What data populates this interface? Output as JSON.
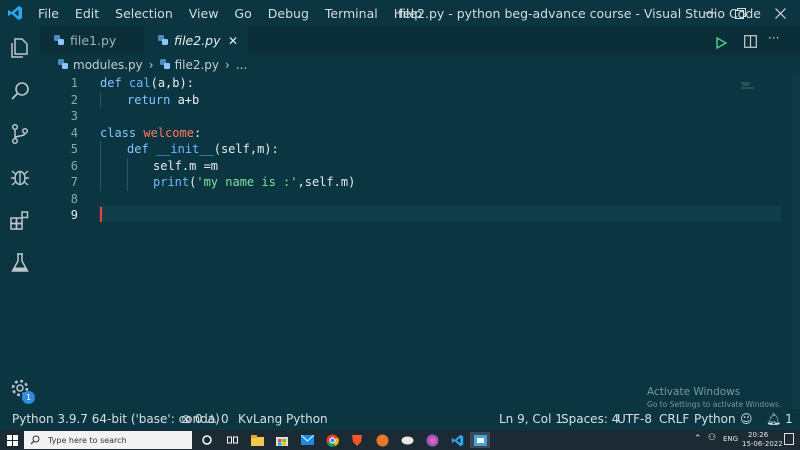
{
  "titlebar": {
    "menu": [
      "File",
      "Edit",
      "Selection",
      "View",
      "Go",
      "Debug",
      "Terminal",
      "Help"
    ],
    "title": "file2.py - python beg-advance course - Visual Studio Code"
  },
  "activitybar": {
    "icons": [
      "files-icon",
      "search-icon",
      "source-control-icon",
      "debug-icon",
      "extensions-icon",
      "flask-icon"
    ],
    "settings_badge": "1"
  },
  "tabs": [
    {
      "label": "file1.py",
      "active": false
    },
    {
      "label": "file2.py",
      "active": true,
      "close": "✕"
    }
  ],
  "breadcrumb": {
    "items": [
      "modules.py",
      "file2.py",
      "..."
    ]
  },
  "editor": {
    "lines": [
      {
        "num": "1"
      },
      {
        "num": "2"
      },
      {
        "num": "3"
      },
      {
        "num": "4"
      },
      {
        "num": "5"
      },
      {
        "num": "6"
      },
      {
        "num": "7"
      },
      {
        "num": "8"
      },
      {
        "num": "9"
      }
    ],
    "tokens": {
      "l1_kw": "def",
      "l1_fn": "cal",
      "l1_rest": "(a,b):",
      "l2_kw": "return",
      "l2_rest": " a+b",
      "l4_kw": "class",
      "l4_cls": "welcome",
      "l4_rest": ":",
      "l5_kw": "def",
      "l5_fn": "__init__",
      "l5_rest": "(self,m):",
      "l6_rest": "self.m =m",
      "l7_fn": "print",
      "l7_p1": "(",
      "l7_str": "'my name is :'",
      "l7_p2": ",self.m)"
    }
  },
  "watermark": {
    "line1": "Activate Windows",
    "line2": "Go to Settings to activate Windows."
  },
  "statusbar": {
    "interpreter": "Python 3.9.7 64-bit ('base': conda)",
    "errors": "0",
    "warnings": "0",
    "kvlang": "KvLang Python",
    "position": "Ln 9, Col 1",
    "spaces": "Spaces: 4",
    "encoding": "UTF-8",
    "eol": "CRLF",
    "language": "Python",
    "notifications": "1"
  },
  "taskbar": {
    "search_placeholder": "Type here to search",
    "lang": "ENG",
    "time": "20:26",
    "date": "15-06-2022"
  },
  "colors": {
    "background": "#0b3540",
    "keyword": "#84c6ff",
    "class_name": "#ff7a5a",
    "string": "#7fe0a0",
    "cursor": "#ff3b3b"
  }
}
